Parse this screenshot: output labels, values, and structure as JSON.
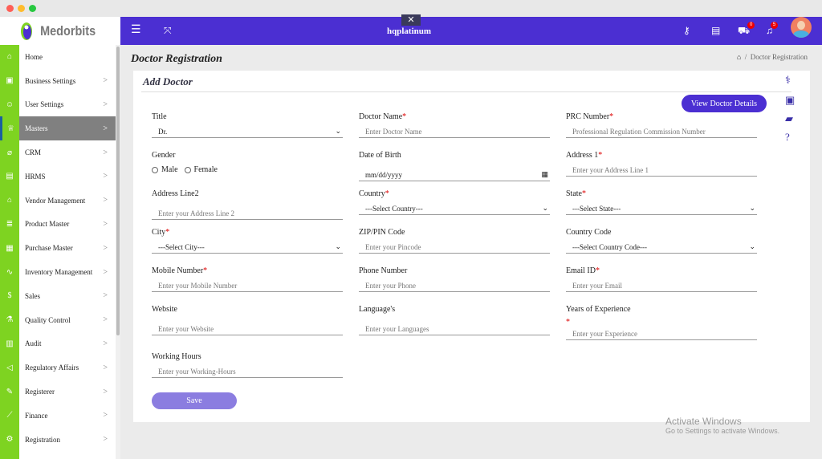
{
  "brand": "Medorbits",
  "header": {
    "title": "hqplatinum",
    "cart_count": "0",
    "notif_count": "5"
  },
  "sidebar": {
    "items": [
      {
        "label": "Home",
        "chev": false
      },
      {
        "label": "Business Settings",
        "chev": true
      },
      {
        "label": "User Settings",
        "chev": true
      },
      {
        "label": "Masters",
        "chev": true,
        "active": true
      },
      {
        "label": "CRM",
        "chev": true
      },
      {
        "label": "HRMS",
        "chev": true
      },
      {
        "label": "Vendor Management",
        "chev": true
      },
      {
        "label": "Product Master",
        "chev": true
      },
      {
        "label": "Purchase Master",
        "chev": true
      },
      {
        "label": "Inventory Management",
        "chev": true
      },
      {
        "label": "Sales",
        "chev": true
      },
      {
        "label": "Quality Control",
        "chev": true
      },
      {
        "label": "Audit",
        "chev": true
      },
      {
        "label": "Regulatory Affairs",
        "chev": true
      },
      {
        "label": "Registerer",
        "chev": true
      },
      {
        "label": "Finance",
        "chev": true
      },
      {
        "label": "Registration",
        "chev": true
      }
    ],
    "icons": [
      "⌂",
      "▣",
      "☺",
      "♕",
      "⌀",
      "▤",
      "⌂",
      "≣",
      "▦",
      "∿",
      "$",
      "⚗",
      "▥",
      "◁",
      "✎",
      "⟋",
      "⚙"
    ]
  },
  "page": {
    "title": "Doctor Registration",
    "breadcrumb": "Doctor Registration",
    "card_title": "Add Doctor",
    "view_button": "View Doctor Details",
    "save_button": "Save"
  },
  "form": {
    "title": {
      "label": "Title",
      "value": "Dr."
    },
    "doctor_name": {
      "label": "Doctor Name",
      "placeholder": "Enter Doctor Name"
    },
    "prc": {
      "label": "PRC Number",
      "placeholder": "Professional Regulation Commission Number"
    },
    "gender": {
      "label": "Gender",
      "male": "Male",
      "female": "Female"
    },
    "dob": {
      "label": "Date of Birth",
      "placeholder": "mm/dd/yyyy"
    },
    "address1": {
      "label": "Address 1",
      "placeholder": "Enter your Address Line 1"
    },
    "address2": {
      "label": "Address Line2",
      "placeholder": "Enter your Address Line 2"
    },
    "country": {
      "label": "Country",
      "value": "---Select Country---"
    },
    "state": {
      "label": "State",
      "value": "---Select State---"
    },
    "city": {
      "label": "City",
      "value": "---Select City---"
    },
    "zip": {
      "label": "ZIP/PIN Code",
      "placeholder": "Enter your Pincode"
    },
    "country_code": {
      "label": "Country Code",
      "value": "---Select Country Code---"
    },
    "mobile": {
      "label": "Mobile Number",
      "placeholder": "Enter your Mobile Number"
    },
    "phone": {
      "label": "Phone Number",
      "placeholder": "Enter your Phone"
    },
    "email": {
      "label": "Email ID",
      "placeholder": "Enter your Email"
    },
    "website": {
      "label": "Website",
      "placeholder": "Enter your Website"
    },
    "languages": {
      "label": "Language's",
      "placeholder": "Enter your Languages"
    },
    "experience": {
      "label": "Years of Experience",
      "placeholder": "Enter your Experience"
    },
    "working_hours": {
      "label": "Working Hours",
      "placeholder": "Enter your Working-Hours"
    }
  },
  "watermark": {
    "line1": "Activate Windows",
    "line2": "Go to Settings to activate Windows."
  }
}
